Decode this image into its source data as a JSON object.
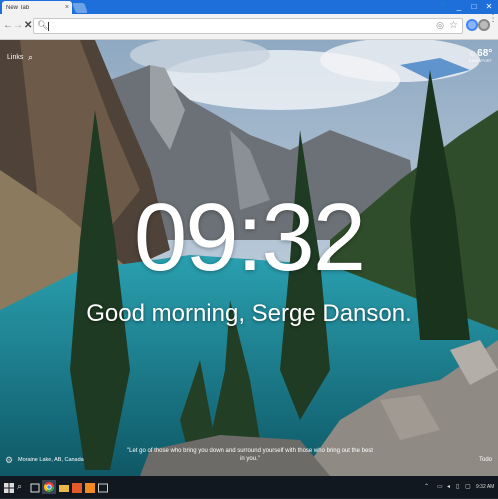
{
  "browser": {
    "tab_title": "New Tab",
    "tab_close": "×",
    "window_controls": [
      "_",
      "□",
      "✕"
    ],
    "nav": {
      "back": "←",
      "forward": "→",
      "reload": "✕"
    }
  },
  "newtab": {
    "links_label": "Links",
    "weather_temp": "68°",
    "weather_location": "DAVENPORT",
    "time": "09:32",
    "greeting": "Good morning, Serge Danson.",
    "photo_location": "Moraine Lake, AB, Canada",
    "quote": "\"Let go of those who bring you down and surround yourself with those who bring out the best in you.\"",
    "todo_label": "Todo"
  },
  "taskbar": {
    "clock": "9:32 AM",
    "tray_icons": [
      "chevron-up-icon",
      "network-icon",
      "volume-icon",
      "battery-icon",
      "notification-icon"
    ]
  },
  "colors": {
    "tabstrip": "#1e6fd9",
    "toolbar": "#f2f2f2",
    "taskbar": "#111820",
    "lake": "#1f7f8f"
  }
}
